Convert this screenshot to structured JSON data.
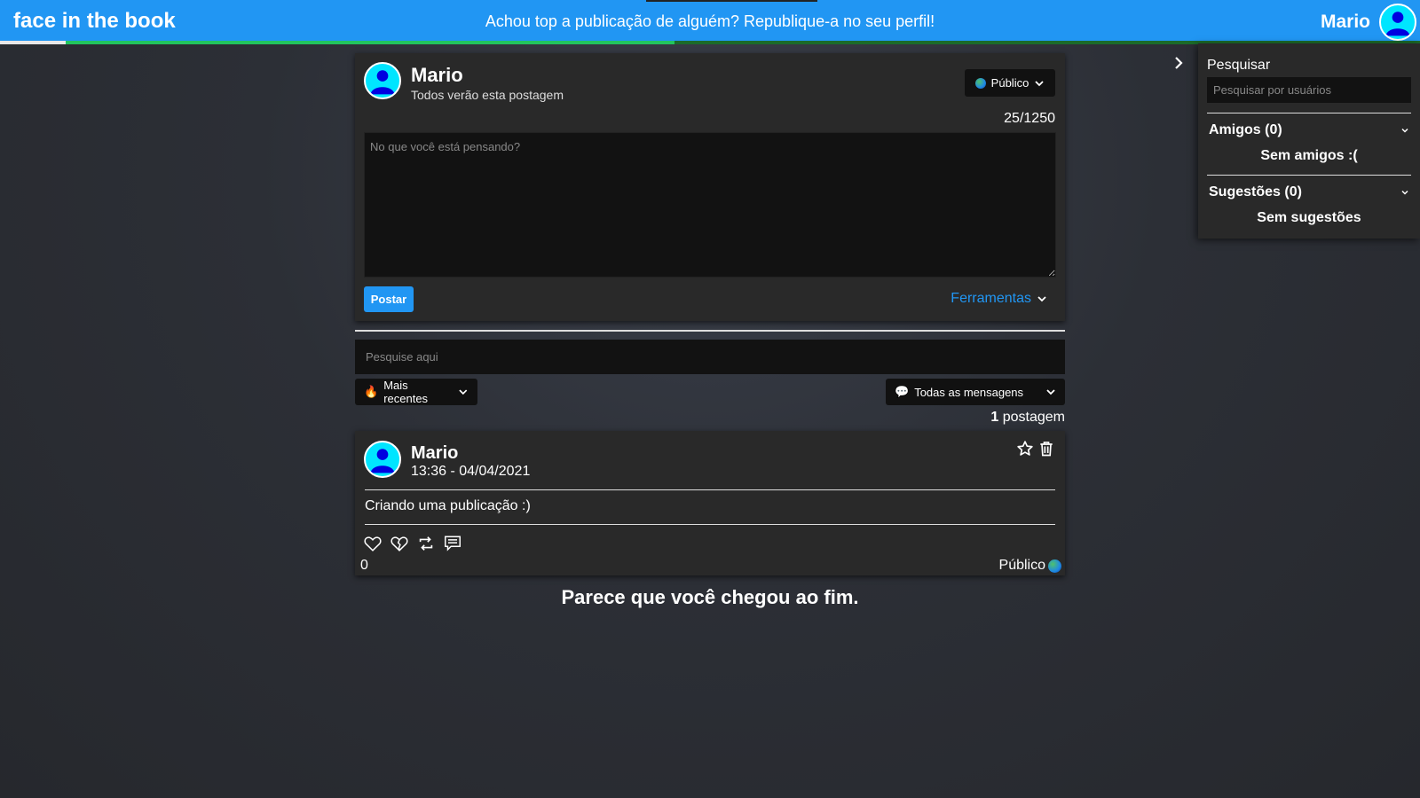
{
  "header": {
    "brand": "face in the book",
    "marquee": "Achou top a publicação de alguém? Republique-a no seu perfil!",
    "username": "Mario",
    "progress_fraction": 0.475
  },
  "composer": {
    "username": "Mario",
    "subtitle": "Todos verão esta postagem",
    "privacy_label": "Público",
    "char_counter": "25/1250",
    "textarea_placeholder": "No que você está pensando?",
    "post_button": "Postar",
    "tools_label": "Ferramentas"
  },
  "feed": {
    "search_placeholder": "Pesquise aqui",
    "sort_label": "Mais recentes",
    "sort_icon": "🔥",
    "filter_label": "Todas as mensagens",
    "filter_icon": "💬",
    "post_count": "1",
    "post_count_label": "postagem",
    "end_message": "Parece que você chegou ao fim."
  },
  "posts": [
    {
      "username": "Mario",
      "datetime": "13:36 - 04/04/2021",
      "content": "Criando uma publicação :)",
      "likes": "0",
      "privacy": "Público"
    }
  ],
  "sidebar": {
    "search_title": "Pesquisar",
    "search_placeholder": "Pesquisar por usuários",
    "friends_title": "Amigos (0)",
    "friends_empty": "Sem amigos :(",
    "suggestions_title": "Sugestões (0)",
    "suggestions_empty": "Sem sugestões"
  },
  "colors": {
    "accent": "#2196f3",
    "progress": "#22c55e",
    "card": "#292929",
    "avatar": "#00e5ff"
  }
}
